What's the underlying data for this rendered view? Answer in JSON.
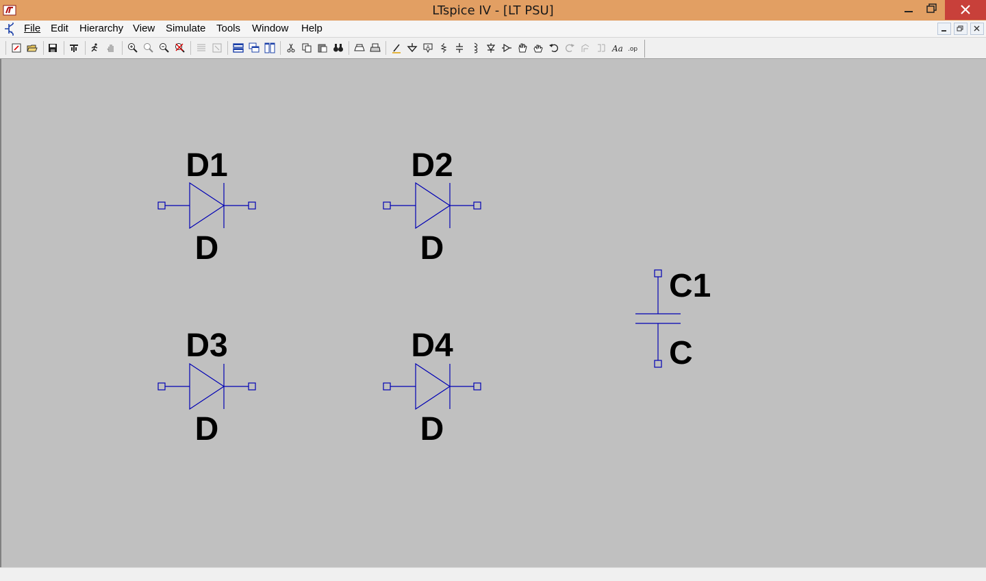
{
  "window": {
    "title": "LTspice IV - [LT PSU]",
    "titlebar_color": "#e29f63",
    "close_color": "#c8403a"
  },
  "menu": {
    "items": [
      {
        "label": "File"
      },
      {
        "label": "Edit"
      },
      {
        "label": "Hierarchy"
      },
      {
        "label": "View"
      },
      {
        "label": "Simulate"
      },
      {
        "label": "Tools"
      },
      {
        "label": "Window"
      },
      {
        "label": "Help"
      }
    ]
  },
  "toolbar": {
    "icons": [
      "new-schematic-icon",
      "open-icon",
      "save-icon",
      "control-panel-icon",
      "run-icon",
      "halt-icon",
      "zoom-in-icon",
      "zoom-fit-icon",
      "zoom-out-icon",
      "zoom-cancel-icon",
      "autorange-icon",
      "autorange-y-icon",
      "tile-horizontal-icon",
      "cascade-icon",
      "tile-vertical-icon",
      "cut-icon",
      "copy-icon",
      "paste-icon",
      "find-icon",
      "print-preview-icon",
      "print-icon",
      "draw-wire-icon",
      "ground-icon",
      "label-net-icon",
      "resistor-icon",
      "capacitor-icon",
      "inductor-icon",
      "diode-icon",
      "component-icon",
      "move-icon",
      "drag-icon",
      "undo-icon",
      "redo-icon",
      "rotate-icon",
      "mirror-icon",
      "text-icon",
      "spice-directive-icon"
    ]
  },
  "schematic": {
    "wire_color": "#0000b4",
    "canvas_color": "#c0c0c0",
    "components": [
      {
        "type": "diode",
        "name": "D1",
        "value": "D"
      },
      {
        "type": "diode",
        "name": "D2",
        "value": "D"
      },
      {
        "type": "diode",
        "name": "D3",
        "value": "D"
      },
      {
        "type": "diode",
        "name": "D4",
        "value": "D"
      },
      {
        "type": "capacitor",
        "name": "C1",
        "value": "C"
      }
    ]
  }
}
